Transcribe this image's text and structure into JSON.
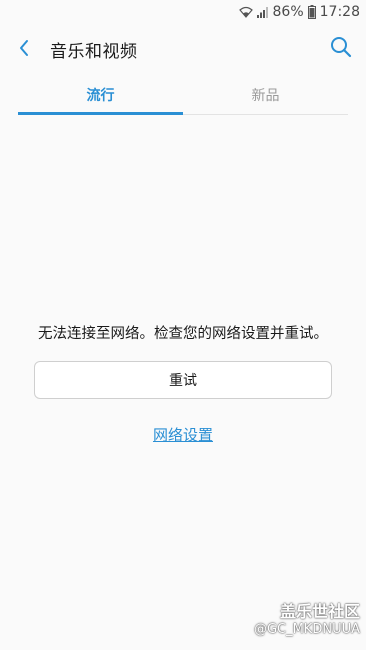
{
  "status_bar": {
    "battery_percent": "86%",
    "time": "17:28",
    "icons": [
      "wifi-icon",
      "signal-icon",
      "battery-icon"
    ]
  },
  "header": {
    "title": "音乐和视频",
    "back_icon": "back-arrow-icon",
    "search_icon": "search-icon"
  },
  "tabs": [
    {
      "label": "流行",
      "active": true
    },
    {
      "label": "新品",
      "active": false
    }
  ],
  "content": {
    "error_message": "无法连接至网络。检查您的网络设置并重试。",
    "retry_label": "重试",
    "network_settings_label": "网络设置"
  },
  "watermark": {
    "title": "盖乐世社区",
    "user": "@GC_MKDNUUA"
  },
  "colors": {
    "accent": "#2a8fd4",
    "background": "#fafafa"
  }
}
